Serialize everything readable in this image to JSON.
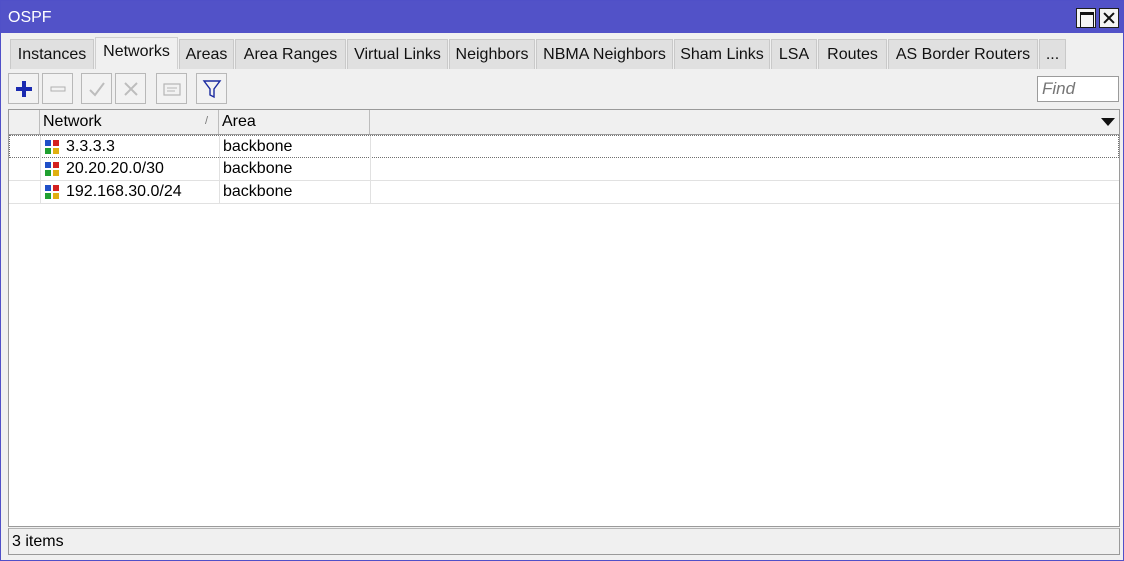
{
  "window": {
    "title": "OSPF"
  },
  "tabs": [
    {
      "label": "Instances",
      "active": false
    },
    {
      "label": "Networks",
      "active": true
    },
    {
      "label": "Areas",
      "active": false
    },
    {
      "label": "Area Ranges",
      "active": false
    },
    {
      "label": "Virtual Links",
      "active": false
    },
    {
      "label": "Neighbors",
      "active": false
    },
    {
      "label": "NBMA Neighbors",
      "active": false
    },
    {
      "label": "Sham Links",
      "active": false
    },
    {
      "label": "LSA",
      "active": false
    },
    {
      "label": "Routes",
      "active": false
    },
    {
      "label": "AS Border Routers",
      "active": false
    },
    {
      "label": "...",
      "active": false
    }
  ],
  "toolbar": {
    "add_icon": "plus-icon",
    "remove_icon": "minus-icon",
    "enable_icon": "check-icon",
    "disable_icon": "x-icon",
    "comment_icon": "comment-icon",
    "filter_icon": "filter-icon",
    "find_placeholder": "Find"
  },
  "table": {
    "columns": [
      "Network",
      "Area"
    ],
    "rows": [
      {
        "network": "3.3.3.3",
        "area": "backbone",
        "selected": true
      },
      {
        "network": "20.20.20.0/30",
        "area": "backbone",
        "selected": false
      },
      {
        "network": "192.168.30.0/24",
        "area": "backbone",
        "selected": false
      }
    ]
  },
  "status": {
    "text": "3 items"
  },
  "colors": {
    "titlebar": "#5252c8",
    "add_icon": "#1a2ab0",
    "icon_red": "#d42020",
    "icon_blue": "#2050c8",
    "icon_green": "#20a030",
    "icon_yellow": "#e0b010"
  }
}
